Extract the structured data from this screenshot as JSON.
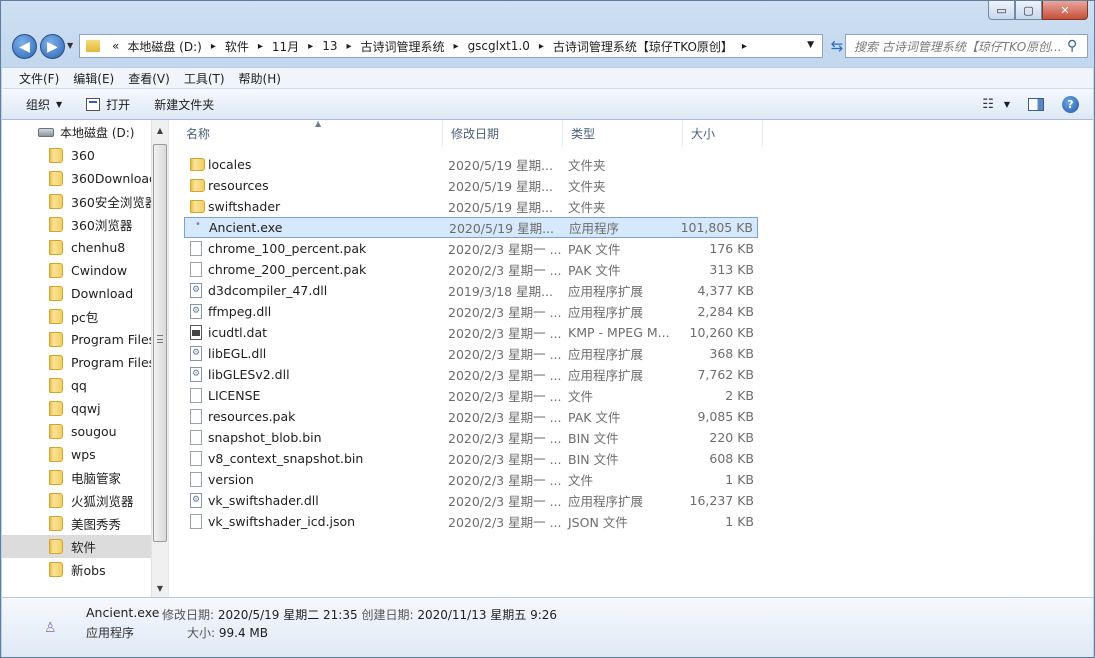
{
  "window": {
    "minimize": "▭",
    "maximize": "▢",
    "close": "✕"
  },
  "address": {
    "overflow": "«",
    "crumbs": [
      "本地磁盘 (D:)",
      "软件",
      "11月",
      "13",
      "古诗词管理系统",
      "gscglxt1.0",
      "古诗词管理系统【琼仔TKO原创】"
    ],
    "separator": "▸"
  },
  "search": {
    "placeholder": "搜索 古诗词管理系统【琼仔TKO原创..."
  },
  "menubar": [
    "文件(F)",
    "编辑(E)",
    "查看(V)",
    "工具(T)",
    "帮助(H)"
  ],
  "toolbar": {
    "organize": "组织",
    "open": "打开",
    "new_folder": "新建文件夹"
  },
  "nav": {
    "root": "本地磁盘 (D:)",
    "items": [
      "360",
      "360Download",
      "360安全浏览器",
      "360浏览器",
      "chenhu8",
      "Cwindow",
      "Download",
      "pc包",
      "Program Files",
      "Program Files",
      "qq",
      "qqwj",
      "sougou",
      "wps",
      "电脑管家",
      "火狐浏览器",
      "美图秀秀",
      "软件",
      "新obs"
    ],
    "selected_index": 17
  },
  "columns": {
    "name": "名称",
    "date": "修改日期",
    "type": "类型",
    "size": "大小"
  },
  "files": [
    {
      "name": "locales",
      "date": "2020/5/19 星期...",
      "type": "文件夹",
      "size": "",
      "icon": "folder-icon"
    },
    {
      "name": "resources",
      "date": "2020/5/19 星期...",
      "type": "文件夹",
      "size": "",
      "icon": "folder-icon"
    },
    {
      "name": "swiftshader",
      "date": "2020/5/19 星期...",
      "type": "文件夹",
      "size": "",
      "icon": "folder-icon"
    },
    {
      "name": "Ancient.exe",
      "date": "2020/5/19 星期...",
      "type": "应用程序",
      "size": "101,805 KB",
      "icon": "exe-icon",
      "selected": true
    },
    {
      "name": "chrome_100_percent.pak",
      "date": "2020/2/3 星期一 ...",
      "type": "PAK 文件",
      "size": "176 KB",
      "icon": "file-icon"
    },
    {
      "name": "chrome_200_percent.pak",
      "date": "2020/2/3 星期一 ...",
      "type": "PAK 文件",
      "size": "313 KB",
      "icon": "file-icon"
    },
    {
      "name": "d3dcompiler_47.dll",
      "date": "2019/3/18 星期...",
      "type": "应用程序扩展",
      "size": "4,377 KB",
      "icon": "dll-icon"
    },
    {
      "name": "ffmpeg.dll",
      "date": "2020/2/3 星期一 ...",
      "type": "应用程序扩展",
      "size": "2,284 KB",
      "icon": "dll-icon"
    },
    {
      "name": "icudtl.dat",
      "date": "2020/2/3 星期一 ...",
      "type": "KMP - MPEG M...",
      "size": "10,260 KB",
      "icon": "dat-icon"
    },
    {
      "name": "libEGL.dll",
      "date": "2020/2/3 星期一 ...",
      "type": "应用程序扩展",
      "size": "368 KB",
      "icon": "dll-icon"
    },
    {
      "name": "libGLESv2.dll",
      "date": "2020/2/3 星期一 ...",
      "type": "应用程序扩展",
      "size": "7,762 KB",
      "icon": "dll-icon"
    },
    {
      "name": "LICENSE",
      "date": "2020/2/3 星期一 ...",
      "type": "文件",
      "size": "2 KB",
      "icon": "file-icon"
    },
    {
      "name": "resources.pak",
      "date": "2020/2/3 星期一 ...",
      "type": "PAK 文件",
      "size": "9,085 KB",
      "icon": "file-icon"
    },
    {
      "name": "snapshot_blob.bin",
      "date": "2020/2/3 星期一 ...",
      "type": "BIN 文件",
      "size": "220 KB",
      "icon": "file-icon"
    },
    {
      "name": "v8_context_snapshot.bin",
      "date": "2020/2/3 星期一 ...",
      "type": "BIN 文件",
      "size": "608 KB",
      "icon": "file-icon"
    },
    {
      "name": "version",
      "date": "2020/2/3 星期一 ...",
      "type": "文件",
      "size": "1 KB",
      "icon": "file-icon"
    },
    {
      "name": "vk_swiftshader.dll",
      "date": "2020/2/3 星期一 ...",
      "type": "应用程序扩展",
      "size": "16,237 KB",
      "icon": "dll-icon"
    },
    {
      "name": "vk_swiftshader_icd.json",
      "date": "2020/2/3 星期一 ...",
      "type": "JSON 文件",
      "size": "1 KB",
      "icon": "file-icon"
    }
  ],
  "details": {
    "name": "Ancient.exe",
    "modified_label": "修改日期:",
    "modified": "2020/5/19 星期二 21:35",
    "created_label": "创建日期:",
    "created": "2020/11/13 星期五 9:26",
    "type": "应用程序",
    "size_label": "大小:",
    "size": "99.4 MB"
  }
}
